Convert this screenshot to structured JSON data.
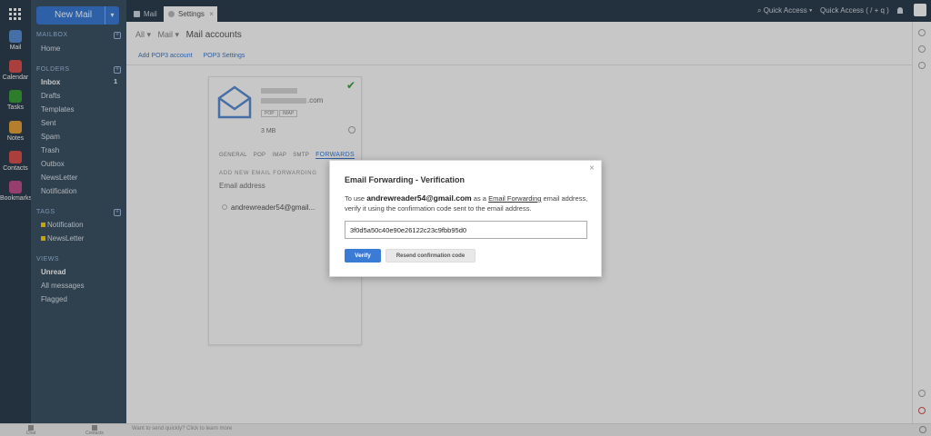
{
  "sidebar": {
    "new_mail_label": "New Mail",
    "sections": {
      "mailbox": "MAILBOX",
      "folders": "FOLDERS",
      "tags": "TAGS",
      "views": "VIEWS"
    },
    "mailbox_items": [
      {
        "label": "Home"
      }
    ],
    "folders": [
      {
        "label": "Inbox",
        "count": "1"
      },
      {
        "label": "Drafts"
      },
      {
        "label": "Templates"
      },
      {
        "label": "Sent"
      },
      {
        "label": "Spam"
      },
      {
        "label": "Trash"
      },
      {
        "label": "Outbox"
      },
      {
        "label": "NewsLetter"
      },
      {
        "label": "Notification"
      }
    ],
    "tags": [
      {
        "label": "Notification"
      },
      {
        "label": "NewsLetter"
      }
    ],
    "views": [
      {
        "label": "Unread"
      },
      {
        "label": "All messages"
      },
      {
        "label": "Flagged"
      }
    ]
  },
  "apprail": {
    "items": [
      {
        "label": "Mail",
        "icon": "mail-icon"
      },
      {
        "label": "Calendar",
        "icon": "calendar-icon"
      },
      {
        "label": "Tasks",
        "icon": "tasks-icon"
      },
      {
        "label": "Notes",
        "icon": "notes-icon"
      },
      {
        "label": "Contacts",
        "icon": "contacts-icon"
      },
      {
        "label": "Bookmarks",
        "icon": "bookmarks-icon"
      }
    ]
  },
  "topbar": {
    "tabs": [
      {
        "label": "Mail"
      },
      {
        "label": "Settings",
        "close": "×"
      }
    ],
    "quick_access_1": "Quick Access ▾",
    "quick_access_2": "Quick Access ( / + q )"
  },
  "breadcrumb": {
    "all": "All ▾",
    "mail": "Mail ▾",
    "current": "Mail accounts"
  },
  "subnav": {
    "add_pop": "Add POP3 account",
    "pop_settings": "POP3 Settings"
  },
  "card": {
    "email_domain": ".com",
    "badges": [
      "POP",
      "IMAP"
    ],
    "size": "3 MB",
    "tabs": [
      "GENERAL",
      "POP",
      "IMAP",
      "SMTP",
      "FORWARDS"
    ],
    "add_forwarding": "ADD NEW EMAIL FORWARDING",
    "email_address_label": "Email address",
    "forward_entry": "andrewreader54@gmail..."
  },
  "statusbar": {
    "item1": "Chat",
    "item2": "Contacts",
    "tip": "Want to send quickly? Click to learn more"
  },
  "modal": {
    "close": "×",
    "title": "Email Forwarding - Verification",
    "body_prefix": "To use ",
    "body_email": "andrewreader54@gmail.com",
    "body_mid": " as a ",
    "body_link": "Email Forwarding",
    "body_suffix": " email address, verify it using the confirmation code sent to the email address.",
    "code_value": "3f0d5a50c40e90e26122c23c9fbb95d0",
    "verify_label": "Verify",
    "resend_label": "Resend confirmation code"
  },
  "colors": {
    "accent": "#3a7bd5",
    "sidebar_bg": "#3d5366",
    "rail_bg": "#2e3f50",
    "success": "#3aa03a"
  }
}
